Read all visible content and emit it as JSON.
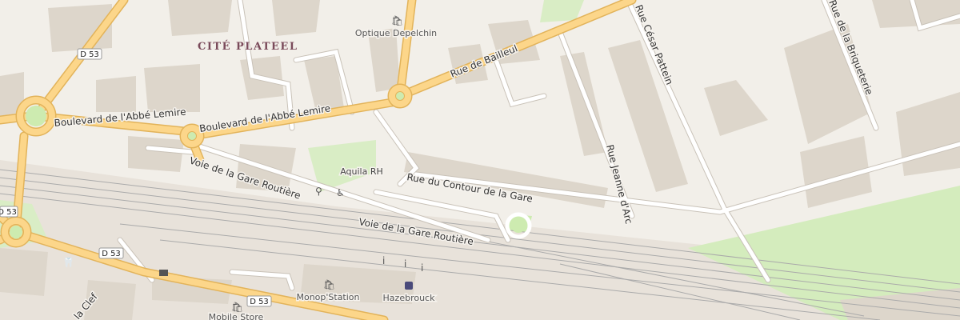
{
  "map": {
    "district": "CITÉ PLATEEL",
    "roads": {
      "rue_de_bailleul": "Rue de Bailleul",
      "rue_cesar_pattein": "Rue César Pattein",
      "rue_briqueterie": "Rue de la Briqueterie",
      "blvd_abbe_lemire_1": "Boulevard de l'Abbé Lemire",
      "blvd_abbe_lemire_2": "Boulevard de l'Abbé Lemire",
      "voie_gare_1": "Voie de la Gare Routière",
      "voie_gare_2": "Voie de la Gare Routière",
      "rue_contour_gare": "Rue du Contour de la Gare",
      "rue_jeanne_darc": "Rue Jeanne d'Arc",
      "rue_la_clef": "la Clef"
    },
    "shields": [
      "D 53",
      "D 53",
      "D 53",
      "D 53"
    ],
    "pois": {
      "optique": "Optique Depelchin",
      "aquila": "Aquila RH",
      "monop": "Monop'Station",
      "hazebrouck": "Hazebrouck",
      "mobile_store": "Mobile Store"
    },
    "colors": {
      "background": "#f2efe9",
      "building": "#dcd5ca",
      "primary_road": "#fcd68a",
      "primary_road_casing": "#e2b35a",
      "minor_road": "#ffffff",
      "rail": "#999999",
      "grass": "#cdebb0",
      "railway_area": "#e6e0d8"
    },
    "icons": [
      "shop-icon",
      "shop-icon",
      "shop-icon",
      "bicycle-icon",
      "wheelchair-icon",
      "info-icon",
      "info-icon",
      "info-icon",
      "train-icon",
      "post-office-icon",
      "dentist-icon"
    ]
  }
}
